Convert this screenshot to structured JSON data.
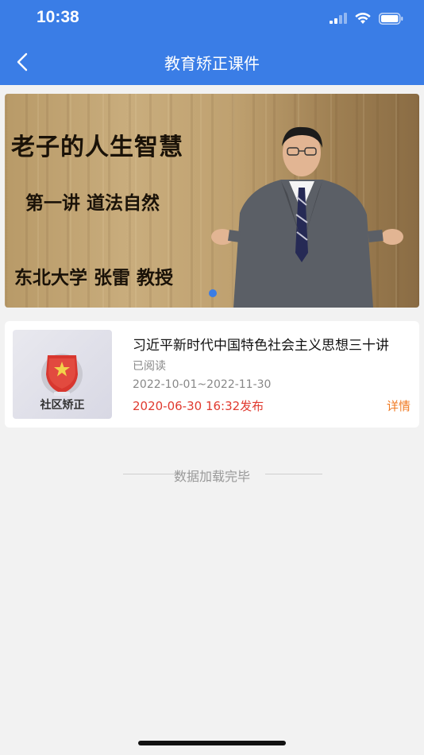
{
  "status_bar": {
    "time": "10:38"
  },
  "nav": {
    "title": "教育矫正课件",
    "back_icon": "chevron-left-icon"
  },
  "banner": {
    "line1": "老子的人生智慧",
    "line2": "第一讲  道法自然",
    "line3": "东北大学 张雷 教授",
    "indicator_color": "#3a7de6"
  },
  "course": {
    "thumb_label": "社区矫正",
    "title": "习近平新时代中国特色社会主义思想三十讲",
    "read_status": "已阅读",
    "date_range": "2022-10-01~2022-11-30",
    "publish": "2020-06-30 16:32发布",
    "detail": "详情"
  },
  "list_end": "数据加载完毕",
  "colors": {
    "brand": "#3a7de6",
    "publish": "#e03a2f",
    "detail": "#f07a22"
  }
}
